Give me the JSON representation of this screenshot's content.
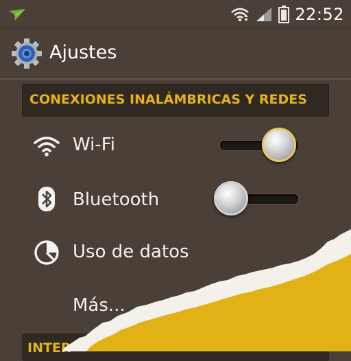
{
  "status_bar": {
    "time": "22:52",
    "icons": [
      "notification-arrow-icon",
      "wifi-signal-icon",
      "cell-signal-icon",
      "battery-icon"
    ]
  },
  "app_bar": {
    "icon": "settings-gear-icon",
    "title": "Ajustes"
  },
  "sections": [
    {
      "title": "CONEXIONES INALÁMBRICAS Y REDES",
      "items": [
        {
          "label": "Wi-Fi",
          "icon": "wifi-icon",
          "switch_state": "on"
        },
        {
          "label": "Bluetooth",
          "icon": "bluetooth-icon",
          "switch_state": "off"
        },
        {
          "label": "Uso de datos",
          "icon": "data-usage-icon"
        },
        {
          "label": "Más..."
        }
      ]
    },
    {
      "title": "INTER"
    }
  ],
  "colors": {
    "background": "#4a4037",
    "section_header_bg": "#2f2922",
    "accent_yellow": "#e6b21e",
    "torn_paper_yellow": "#e2b115"
  }
}
